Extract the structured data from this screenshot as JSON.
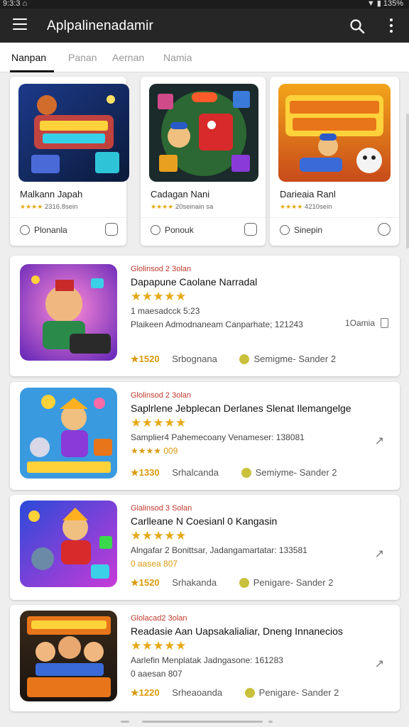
{
  "status": {
    "left": "9:3:3 ⌂",
    "right": "▼ ▮ 135%"
  },
  "appbar": {
    "title": "Aplpalinenadamir"
  },
  "tabs": [
    {
      "label": "Nanpan",
      "active": true
    },
    {
      "label": "Panan",
      "active": false
    },
    {
      "label": "Aernan",
      "active": false
    },
    {
      "label": "Namia",
      "active": false
    }
  ],
  "top_cards": [
    {
      "name": "Malkann Japah",
      "rating_stars": "★★★★",
      "rating_text": "2316.8sein",
      "action": "Plonanla"
    },
    {
      "name": "Cadagan Nani",
      "rating_stars": "★★★★",
      "rating_text": "20seinain sa",
      "action": "Ponouk"
    },
    {
      "name": "Darieaia Ranl",
      "rating_stars": "★★★★",
      "rating_text": "4210sein",
      "action": "Sinepin"
    }
  ],
  "list_cards": [
    {
      "category": "Glolinsod 2 3olan",
      "title": "Dapapune Caolane Narradal",
      "stars": "★★★★★",
      "meta1": "1 maesadcck 5:23",
      "meta2": "Plaikeen Admodnaneam Canparhate; 121243",
      "side_label": "1Oamia",
      "price": "★1520",
      "seller": "Srbognana",
      "tag": "Semigme- Sander 2"
    },
    {
      "category": "Glolinsod 2 3olan",
      "title": "Saplrlene Jebplecan Derlanes Slenat Ilemangelge",
      "stars": "★★★★★",
      "meta1": "Samplier4 Pahemecoany Venameser: 138081",
      "meta2": "★★★★ 009",
      "side_label": "",
      "price": "★1330",
      "seller": "Srhalcanda",
      "tag": "Semiyme- Sander 2"
    },
    {
      "category": "Glalinsod 3 Solan",
      "title": "Carlleane N Coesianl 0 Kangasin",
      "stars": "★★★★★",
      "meta1": "Alngafar 2 Bonittsar, Jadangamartatar: 133581",
      "meta2": "0 aasea 807",
      "side_label": "",
      "price": "★1520",
      "seller": "Srhakanda",
      "tag": "Penigare- Sander 2"
    },
    {
      "category": "Glolacad2 3olan",
      "title": "Readasie Aan Uapsakalialiar, Dneng Innanecios",
      "stars": "★★★★★",
      "meta1": "Aarlefin Menplatak Jadngasone: 161283",
      "meta2": "0 aaesan 807",
      "side_label": "",
      "price": "★1220",
      "seller": "Srheaoanda",
      "tag": "Penigare- Sander 2"
    }
  ]
}
